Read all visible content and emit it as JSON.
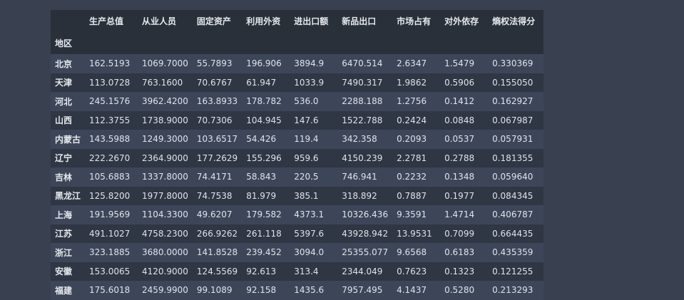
{
  "table": {
    "index_name": "地区",
    "columns": [
      "生产总值",
      "从业人员",
      "固定资产",
      "利用外资",
      "进出口额",
      "新品出口",
      "市场占有",
      "对外依存",
      "熵权法得分"
    ],
    "rows": [
      {
        "region": "北京",
        "values": [
          "162.5193",
          "1069.7000",
          "55.7893",
          "196.906",
          "3894.9",
          "6470.514",
          "2.6347",
          "1.5479",
          "0.330369"
        ]
      },
      {
        "region": "天津",
        "values": [
          "113.0728",
          "763.1600",
          "70.6767",
          "61.947",
          "1033.9",
          "7490.317",
          "1.9862",
          "0.5906",
          "0.155050"
        ]
      },
      {
        "region": "河北",
        "values": [
          "245.1576",
          "3962.4200",
          "163.8933",
          "178.782",
          "536.0",
          "2288.188",
          "1.2756",
          "0.1412",
          "0.162927"
        ]
      },
      {
        "region": "山西",
        "values": [
          "112.3755",
          "1738.9000",
          "70.7306",
          "104.945",
          "147.6",
          "1522.788",
          "0.2424",
          "0.0848",
          "0.067987"
        ]
      },
      {
        "region": "内蒙古",
        "values": [
          "143.5988",
          "1249.3000",
          "103.6517",
          "54.426",
          "119.4",
          "342.358",
          "0.2093",
          "0.0537",
          "0.057931"
        ]
      },
      {
        "region": "辽宁",
        "values": [
          "222.2670",
          "2364.9000",
          "177.2629",
          "155.296",
          "959.6",
          "4150.239",
          "2.2781",
          "0.2788",
          "0.181355"
        ]
      },
      {
        "region": "吉林",
        "values": [
          "105.6883",
          "1337.8000",
          "74.4171",
          "58.843",
          "220.5",
          "746.941",
          "0.2232",
          "0.1348",
          "0.059640"
        ]
      },
      {
        "region": "黑龙江",
        "values": [
          "125.8200",
          "1977.8000",
          "74.7538",
          "81.979",
          "385.1",
          "318.892",
          "0.7887",
          "0.1977",
          "0.084345"
        ]
      },
      {
        "region": "上海",
        "values": [
          "191.9569",
          "1104.3300",
          "49.6207",
          "179.582",
          "4373.1",
          "10326.436",
          "9.3591",
          "1.4714",
          "0.406787"
        ]
      },
      {
        "region": "江苏",
        "values": [
          "491.1027",
          "4758.2300",
          "266.9262",
          "261.118",
          "5397.6",
          "43928.942",
          "13.9531",
          "0.7099",
          "0.664435"
        ]
      },
      {
        "region": "浙江",
        "values": [
          "323.1885",
          "3680.0000",
          "141.8528",
          "239.452",
          "3094.0",
          "25355.077",
          "9.6568",
          "0.6183",
          "0.435359"
        ]
      },
      {
        "region": "安徽",
        "values": [
          "153.0065",
          "4120.9000",
          "124.5569",
          "92.613",
          "313.4",
          "2344.049",
          "0.7623",
          "0.1323",
          "0.121255"
        ]
      },
      {
        "region": "福建",
        "values": [
          "175.6018",
          "2459.9900",
          "99.1089",
          "92.158",
          "1435.6",
          "7957.495",
          "4.1437",
          "0.5280",
          "0.213293"
        ]
      }
    ]
  }
}
